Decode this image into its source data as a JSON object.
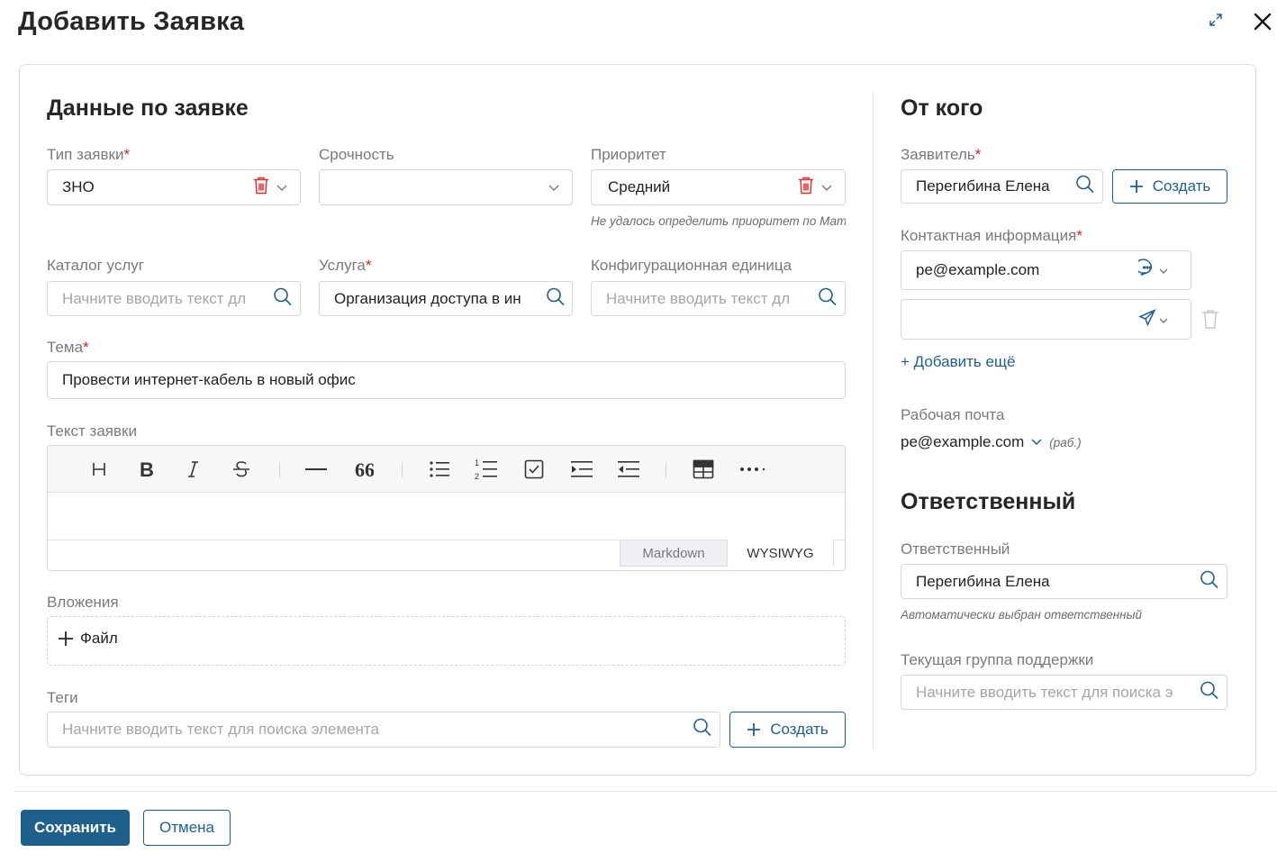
{
  "dialog": {
    "title": "Добавить Заявка"
  },
  "left": {
    "section_title": "Данные по заявке",
    "request_type": {
      "label": "Тип заявки",
      "value": "ЗНО"
    },
    "urgency": {
      "label": "Срочность",
      "value": ""
    },
    "priority": {
      "label": "Приоритет",
      "value": "Средний",
      "hint": "Не удалось определить приоритет по Матр"
    },
    "catalog": {
      "label": "Каталог услуг",
      "placeholder": "Начните вводить текст дл"
    },
    "service": {
      "label": "Услуга",
      "value": "Организация доступа в ин"
    },
    "config_item": {
      "label": "Конфигурационная единица",
      "placeholder": "Начните вводить текст дл"
    },
    "subject": {
      "label": "Тема",
      "value": "Провести интернет-кабель в новый офис"
    },
    "body_text": {
      "label": "Текст заявки",
      "mode_markdown": "Markdown",
      "mode_wysiwyg": "WYSIWYG"
    },
    "attachments": {
      "label": "Вложения",
      "add_file": "Файл"
    },
    "tags": {
      "label": "Теги",
      "placeholder": "Начните вводить текст для поиска элемента",
      "create": "Создать"
    }
  },
  "right": {
    "from_title": "От кого",
    "applicant": {
      "label": "Заявитель",
      "value": "Перегибина Елена",
      "create": "Создать"
    },
    "contact": {
      "label": "Контактная информация",
      "value1": "pe@example.com",
      "value2": "",
      "add_more": "+ Добавить ещё"
    },
    "work_email": {
      "label": "Рабочая почта",
      "value": "pe@example.com",
      "note": "(раб.)"
    },
    "responsible_title": "Ответственный",
    "responsible": {
      "label": "Ответственный",
      "value": "Перегибина Елена",
      "hint": "Автоматически выбран ответственный"
    },
    "support_group": {
      "label": "Текущая группа поддержки",
      "placeholder": "Начните вводить текст для поиска э"
    }
  },
  "footer": {
    "save": "Сохранить",
    "cancel": "Отмена"
  },
  "colors": {
    "accent": "#1f5f8b",
    "required": "#d0202a",
    "trash": "#e03030"
  }
}
